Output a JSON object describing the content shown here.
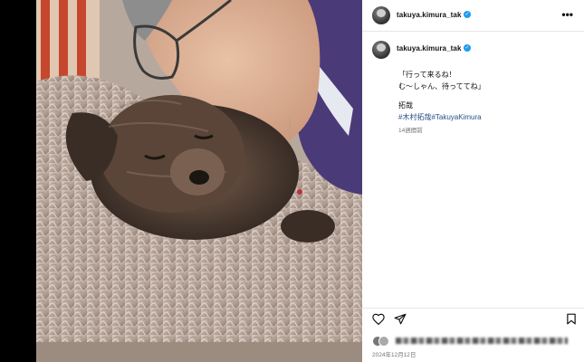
{
  "post": {
    "username": "takuya.kimura_tak",
    "verified_glyph": "✓",
    "more_glyph": "•••",
    "caption": {
      "line1": "「行って来るね！",
      "line2": "む〜しゃん、待っててね」",
      "signature": "拓哉",
      "hashtags": "#木村拓哉#TakuyaKimura",
      "time_ago": "14週間前"
    },
    "date": "2024年12月12日"
  },
  "icons": {
    "avatar": "avatar-icon",
    "like": "heart-icon",
    "share": "paper-plane-icon",
    "save": "bookmark-icon",
    "more": "more-dots-icon",
    "verified": "verified-badge-icon"
  },
  "colors": {
    "verified": "#1d9bf0",
    "hashtag": "#2a4f8a",
    "muted": "#737373"
  }
}
